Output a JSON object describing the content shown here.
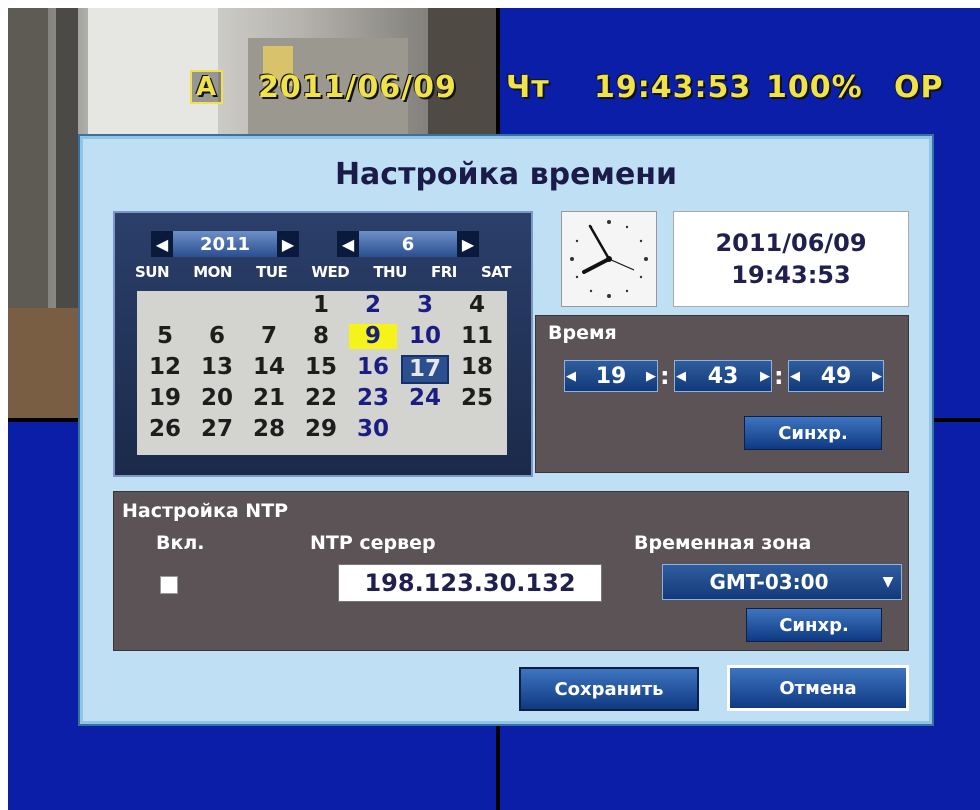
{
  "osd": {
    "channel": "A",
    "date": "2011/06/09",
    "weekday": "Чт",
    "time": "19:43:53",
    "percent": "100%",
    "mode": "OP"
  },
  "dialog": {
    "title": "Настройка времени"
  },
  "calendar": {
    "year": "2011",
    "month": "6",
    "weekdays": [
      "SUN",
      "MON",
      "TUE",
      "WED",
      "THU",
      "FRI",
      "SAT"
    ],
    "weeks": [
      [
        "",
        "",
        "",
        "1",
        "2",
        "3",
        "4"
      ],
      [
        "5",
        "6",
        "7",
        "8",
        "9",
        "10",
        "11"
      ],
      [
        "12",
        "13",
        "14",
        "15",
        "16",
        "17",
        "18"
      ],
      [
        "19",
        "20",
        "21",
        "22",
        "23",
        "24",
        "25"
      ],
      [
        "26",
        "27",
        "28",
        "29",
        "30",
        "",
        ""
      ]
    ],
    "today": "9",
    "selected": "17"
  },
  "datetime_display": {
    "date": "2011/06/09",
    "time": "19:43:53"
  },
  "time_panel": {
    "label": "Время",
    "hour": "19",
    "minute": "43",
    "second": "49",
    "sync_label": "Синхр."
  },
  "ntp": {
    "label": "Настройка NTP",
    "enable_label": "Вкл.",
    "enabled": false,
    "server_label": "NTP сервер",
    "server": "198.123.30.132",
    "timezone_label": "Временная зона",
    "timezone": "GMT-03:00",
    "sync_label": "Синхр."
  },
  "buttons": {
    "save": "Сохранить",
    "cancel": "Отмена"
  },
  "colors": {
    "osd_yellow": "#f0e24a",
    "dialog_bg": "#bfe0f4",
    "panel_bg": "#5b5356",
    "button_blue": "#1f4f9a",
    "screen_blue": "#0a1ea8",
    "today_highlight": "#f4f41a"
  }
}
